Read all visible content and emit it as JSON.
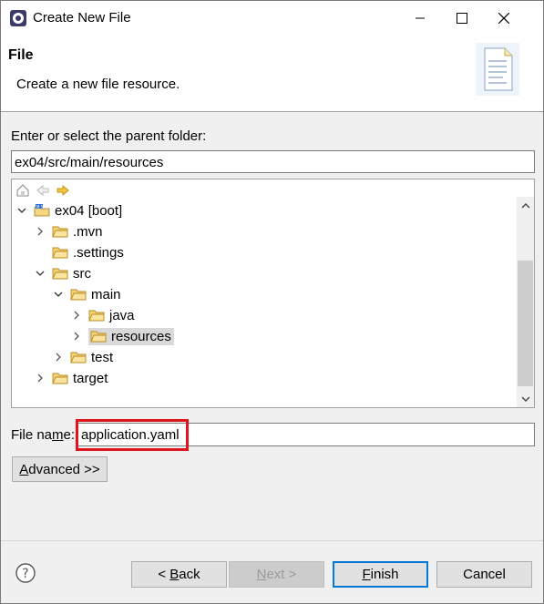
{
  "window": {
    "title": "Create New File"
  },
  "banner": {
    "title": "File",
    "description": "Create a new file resource."
  },
  "parent_folder": {
    "label": "Enter or select the parent folder:",
    "value": "ex04/src/main/resources"
  },
  "tree": {
    "items": [
      {
        "label": "ex04 [boot]",
        "expanded": true,
        "icon": "project-icon"
      },
      {
        "label": ".mvn",
        "expanded": false,
        "icon": "folder-icon"
      },
      {
        "label": ".settings",
        "expanded": null,
        "icon": "folder-icon"
      },
      {
        "label": "src",
        "expanded": true,
        "icon": "folder-icon"
      },
      {
        "label": "main",
        "expanded": true,
        "icon": "folder-icon"
      },
      {
        "label": "java",
        "expanded": false,
        "icon": "folder-icon"
      },
      {
        "label": "resources",
        "expanded": false,
        "icon": "folder-icon",
        "selected": true
      },
      {
        "label": "test",
        "expanded": false,
        "icon": "folder-icon"
      },
      {
        "label": "target",
        "expanded": false,
        "icon": "folder-icon"
      }
    ]
  },
  "file_name": {
    "label_pre": "File na",
    "label_mn": "m",
    "label_post": "e:",
    "value": "application.yaml"
  },
  "buttons": {
    "advanced_u": "A",
    "advanced_rest": "dvanced >>",
    "back_pre": "< ",
    "back_u": "B",
    "back_rest": "ack",
    "next_u": "N",
    "next_rest": "ext >",
    "finish_u": "F",
    "finish_rest": "inish",
    "cancel": "Cancel"
  },
  "colors": {
    "highlight": "#e0141b",
    "default_button_border": "#0078d7",
    "folder": "#e8b43c"
  }
}
